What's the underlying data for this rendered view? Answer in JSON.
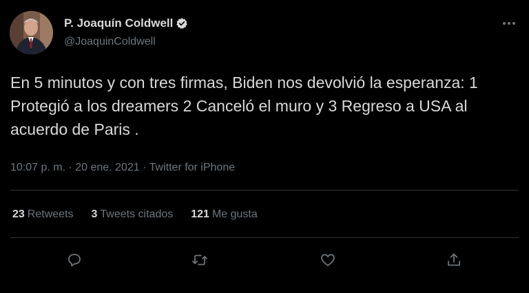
{
  "author": {
    "name": "P. Joaquín Coldwell",
    "handle": "@JoaquinColdwell",
    "verified": true
  },
  "tweet": {
    "text": "En 5 minutos y con tres firmas, Biden nos devolvió la esperanza: 1 Protegió a los dreamers 2 Canceló el muro y 3 Regreso a USA al acuerdo de Paris .",
    "time": "10:07 p. m.",
    "date": "20 ene. 2021",
    "source": "Twitter for iPhone",
    "meta_separator": " · "
  },
  "stats": {
    "retweets_count": "23",
    "retweets_label": "Retweets",
    "quotes_count": "3",
    "quotes_label": "Tweets citados",
    "likes_count": "121",
    "likes_label": "Me gusta"
  },
  "icons": {
    "reply": "reply-icon",
    "retweet": "retweet-icon",
    "like": "heart-icon",
    "share": "share-icon",
    "more": "more-icon",
    "verified": "verified-badge-icon"
  },
  "colors": {
    "background": "#000000",
    "text": "#d9d9d9",
    "secondary": "#6e767d",
    "divider": "#2f3336"
  }
}
